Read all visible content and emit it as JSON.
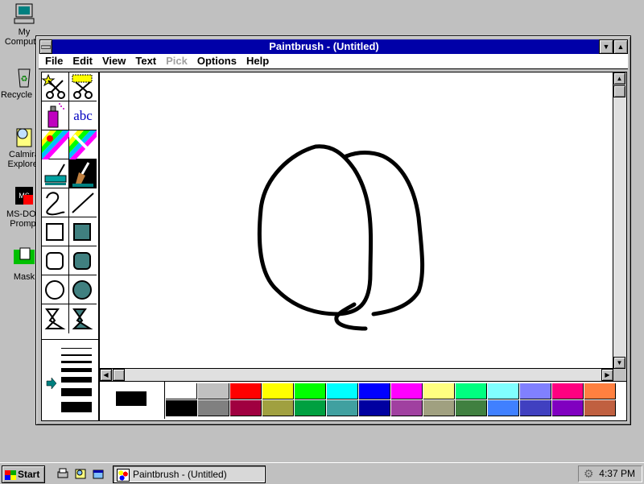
{
  "desktop": {
    "icons": [
      {
        "label": "My Computer"
      },
      {
        "label": "Recycle Bin"
      },
      {
        "label": "Calmira Explorer"
      },
      {
        "label": "MS-DOS Prompt"
      },
      {
        "label": "Mask"
      }
    ]
  },
  "window": {
    "title": "Paintbrush - (Untitled)",
    "menu": [
      "File",
      "Edit",
      "View",
      "Text",
      "Pick",
      "Options",
      "Help"
    ],
    "disabled_menu": [
      "Pick"
    ]
  },
  "toolbox": {
    "tools": [
      "scissors-free",
      "scissors-rect",
      "airbrush",
      "text",
      "color-eraser",
      "eraser",
      "paint-roller",
      "brush",
      "curve",
      "line",
      "box",
      "filled-box",
      "rounded-box",
      "filled-rounded-box",
      "circle",
      "filled-circle",
      "polygon",
      "filled-polygon"
    ],
    "text_tool_label": "abc",
    "selected_tool": "brush"
  },
  "palette": {
    "foreground": "#000000",
    "background": "#ffffff",
    "colors": [
      "#ffffff",
      "#c0c0c0",
      "#ff0000",
      "#ffff00",
      "#00ff00",
      "#00ffff",
      "#0000ff",
      "#ff00ff",
      "#ffff80",
      "#00ff80",
      "#80ffff",
      "#8080ff",
      "#ff0080",
      "#ff8040",
      "#000000",
      "#808080",
      "#a00040",
      "#a0a040",
      "#00a040",
      "#40a0a0",
      "#0000a0",
      "#a040a0",
      "#a0a080",
      "#408040",
      "#4080ff",
      "#4040c0",
      "#8000c0",
      "#c06040"
    ]
  },
  "taskbar": {
    "start_label": "Start",
    "task_label": "Paintbrush - (Untitled)",
    "clock": "4:37 PM"
  }
}
